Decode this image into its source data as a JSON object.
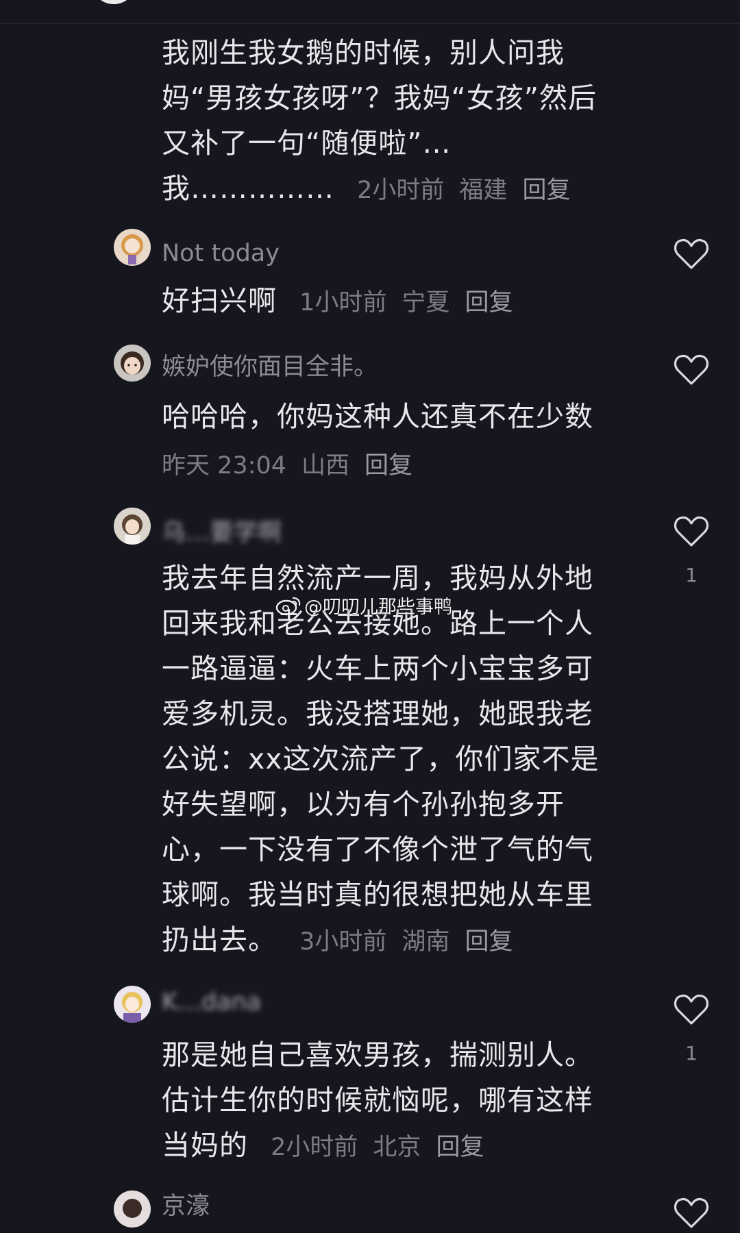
{
  "colors": {
    "background": "#16161e",
    "text_primary": "#e7e7ec",
    "text_secondary": "#7c7c86"
  },
  "top_comment": {
    "text": "我刚生我女鹅的时候，别人问我妈“男孩女孩呀”？我妈“女孩”然后又补了一句“随便啦”…我……………",
    "time": "2小时前",
    "location": "福建",
    "reply_label": "回复"
  },
  "comments": [
    {
      "username": "Not today",
      "text": "好扫兴啊",
      "time": "1小时前",
      "location": "宁夏",
      "reply_label": "回复",
      "like_icon": "heart-outline-icon",
      "like_count": ""
    },
    {
      "username": "嫉妒使你面目全非。",
      "text": "哈哈哈，你妈这种人还真不在少数",
      "time": "昨天 23:04",
      "location": "山西",
      "reply_label": "回复",
      "like_icon": "heart-outline-icon",
      "like_count": ""
    },
    {
      "username": "乌…要学啊",
      "text": "我去年自然流产一周，我妈从外地回来我和老公去接她。路上一个人一路逼逼：火车上两个小宝宝多可爱多机灵。我没搭理她，她跟我老公说：xx这次流产了，你们家不是好失望啊，以为有个孙孙抱多开心，一下没有了不像个泄了气的气球啊。我当时真的很想把她从车里扔出去。",
      "time": "3小时前",
      "location": "湖南",
      "reply_label": "回复",
      "like_icon": "heart-outline-icon",
      "like_count": "1"
    },
    {
      "username": "K…dana",
      "text": "那是她自己喜欢男孩，揣测别人。估计生你的时候就恼呢，哪有这样当妈的",
      "time": "2小时前",
      "location": "北京",
      "reply_label": "回复",
      "like_icon": "heart-outline-icon",
      "like_count": "1"
    }
  ],
  "next_comment_peek": {
    "username": "京濠"
  },
  "watermark": {
    "icon": "weibo-logo-icon",
    "text": "@叨叨儿那些事鸭"
  }
}
